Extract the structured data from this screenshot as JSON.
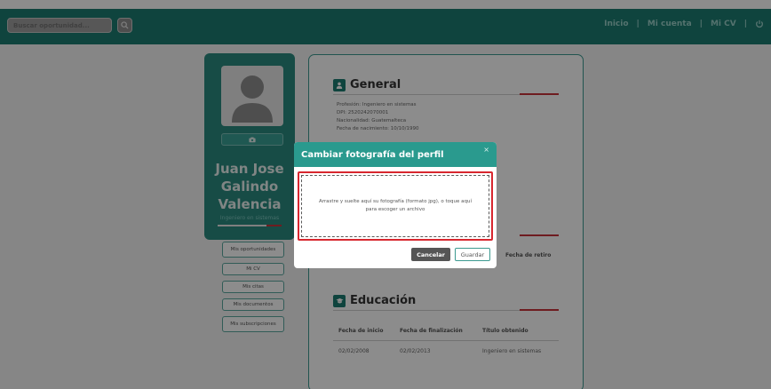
{
  "search": {
    "placeholder": "Buscar oportunidad..."
  },
  "nav": {
    "items": [
      "Inicio",
      "Mi cuenta",
      "Mi CV"
    ],
    "separator": "|"
  },
  "profile": {
    "name_line1": "Juan Jose",
    "name_line2": "Galindo",
    "name_line3": "Valencia",
    "occupation": "Ingeniero en sistemas"
  },
  "side_menu": {
    "items": [
      "Mis oportunidades",
      "Mi CV",
      "Mis citas",
      "Mis documentos",
      "Mis subscripciones"
    ]
  },
  "general": {
    "title": "General",
    "profesion": "Profesión: Ingeniero en sistemas",
    "dpi": "DPI: 2520242070001",
    "nacionalidad": "Nacionalidad: Guatemalteca",
    "nacimiento": "Fecha de nacimiento: 10/10/1990"
  },
  "experience": {
    "col_retiro": "Fecha de retiro"
  },
  "education": {
    "title": "Educación",
    "columns": [
      "Fecha de inicio",
      "Fecha de finalización",
      "Título obtenido"
    ],
    "rows": [
      [
        "02/02/2008",
        "02/02/2013",
        "Ingeniero en sistemas"
      ]
    ]
  },
  "modal": {
    "title": "Cambiar fotografía del perfil",
    "close": "×",
    "dropzone_text": "Arrastre y suelte aquí su fotografía (formato jpg), o toque aquí para escoger un archivo",
    "cancel_label": "Cancelar",
    "save_label": "Guardar"
  },
  "colors": {
    "brand": "#1d7c72",
    "accent_red": "#c9333b",
    "modal_header": "#2a9a8e"
  },
  "icons": {
    "search": "search-icon",
    "power": "power-icon",
    "camera": "camera-icon",
    "user": "user-icon",
    "education": "graduation-icon"
  }
}
